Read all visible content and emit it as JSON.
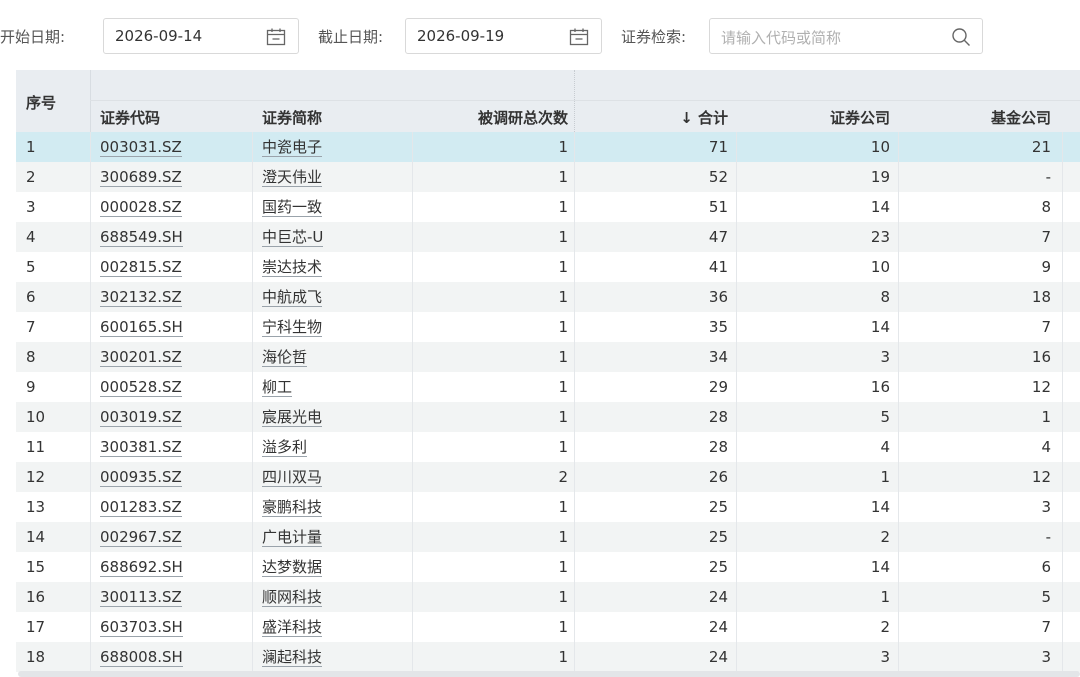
{
  "filters": {
    "start_label": "开始日期:",
    "start_value": "2026-09-14",
    "end_label": "截止日期:",
    "end_value": "2026-09-19",
    "search_label": "证券检索:",
    "search_placeholder": "请输入代码或简称"
  },
  "table": {
    "headers": {
      "seq": "序号",
      "code": "证券代码",
      "name": "证券简称",
      "times": "被调研总次数",
      "total": "↓ 合计",
      "broker": "证券公司",
      "fund": "基金公司"
    },
    "selected_row": 0,
    "rows": [
      {
        "seq": "1",
        "code": "003031.SZ",
        "name": "中瓷电子",
        "times": "1",
        "total": "71",
        "broker": "10",
        "fund": "21"
      },
      {
        "seq": "2",
        "code": "300689.SZ",
        "name": "澄天伟业",
        "times": "1",
        "total": "52",
        "broker": "19",
        "fund": "-"
      },
      {
        "seq": "3",
        "code": "000028.SZ",
        "name": "国药一致",
        "times": "1",
        "total": "51",
        "broker": "14",
        "fund": "8"
      },
      {
        "seq": "4",
        "code": "688549.SH",
        "name": "中巨芯-U",
        "times": "1",
        "total": "47",
        "broker": "23",
        "fund": "7"
      },
      {
        "seq": "5",
        "code": "002815.SZ",
        "name": "崇达技术",
        "times": "1",
        "total": "41",
        "broker": "10",
        "fund": "9"
      },
      {
        "seq": "6",
        "code": "302132.SZ",
        "name": "中航成飞",
        "times": "1",
        "total": "36",
        "broker": "8",
        "fund": "18"
      },
      {
        "seq": "7",
        "code": "600165.SH",
        "name": "宁科生物",
        "times": "1",
        "total": "35",
        "broker": "14",
        "fund": "7"
      },
      {
        "seq": "8",
        "code": "300201.SZ",
        "name": "海伦哲",
        "times": "1",
        "total": "34",
        "broker": "3",
        "fund": "16"
      },
      {
        "seq": "9",
        "code": "000528.SZ",
        "name": "柳工",
        "times": "1",
        "total": "29",
        "broker": "16",
        "fund": "12"
      },
      {
        "seq": "10",
        "code": "003019.SZ",
        "name": "宸展光电",
        "times": "1",
        "total": "28",
        "broker": "5",
        "fund": "1"
      },
      {
        "seq": "11",
        "code": "300381.SZ",
        "name": "溢多利",
        "times": "1",
        "total": "28",
        "broker": "4",
        "fund": "4"
      },
      {
        "seq": "12",
        "code": "000935.SZ",
        "name": "四川双马",
        "times": "2",
        "total": "26",
        "broker": "1",
        "fund": "12"
      },
      {
        "seq": "13",
        "code": "001283.SZ",
        "name": "豪鹏科技",
        "times": "1",
        "total": "25",
        "broker": "14",
        "fund": "3"
      },
      {
        "seq": "14",
        "code": "002967.SZ",
        "name": "广电计量",
        "times": "1",
        "total": "25",
        "broker": "2",
        "fund": "-"
      },
      {
        "seq": "15",
        "code": "688692.SH",
        "name": "达梦数据",
        "times": "1",
        "total": "25",
        "broker": "14",
        "fund": "6"
      },
      {
        "seq": "16",
        "code": "300113.SZ",
        "name": "顺网科技",
        "times": "1",
        "total": "24",
        "broker": "1",
        "fund": "5"
      },
      {
        "seq": "17",
        "code": "603703.SH",
        "name": "盛洋科技",
        "times": "1",
        "total": "24",
        "broker": "2",
        "fund": "7"
      },
      {
        "seq": "18",
        "code": "688008.SH",
        "name": "澜起科技",
        "times": "1",
        "total": "24",
        "broker": "3",
        "fund": "3"
      }
    ]
  },
  "colors": {
    "header_bg": "#e9edf1",
    "row_alt_bg": "#f2f4f4",
    "row_selected_bg": "#d2ebf2"
  },
  "icons": {
    "start_picker": "calendar-icon",
    "end_picker": "calendar-icon",
    "search": "search-icon"
  }
}
